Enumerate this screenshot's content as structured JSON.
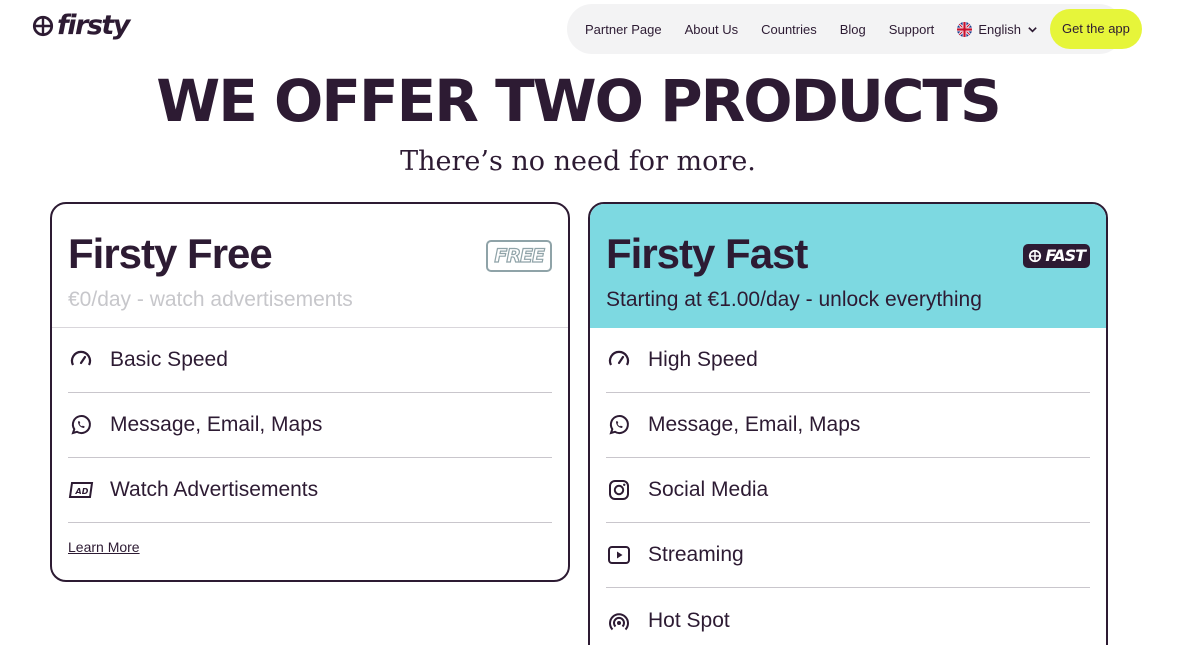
{
  "brand": {
    "name": "firsty"
  },
  "nav": {
    "items": [
      "Partner Page",
      "About Us",
      "Countries",
      "Blog",
      "Support"
    ],
    "language": "English",
    "cta": "Get the app"
  },
  "hero": {
    "title": "WE OFFER TWO PRODUCTS",
    "subtitle": "There’s no need for more."
  },
  "free": {
    "title": "Firsty Free",
    "badge": "FREE",
    "subtitle": "€0/day - watch advertisements",
    "features": [
      {
        "label": "Basic Speed",
        "icon": "speedometer-icon"
      },
      {
        "label": "Message, Email, Maps",
        "icon": "whatsapp-icon"
      },
      {
        "label": "Watch Advertisements",
        "icon": "ad-icon"
      }
    ],
    "learn_more": "Learn More"
  },
  "fast": {
    "title": "Firsty Fast",
    "badge": "FAST",
    "subtitle": "Starting at €1.00/day - unlock everything",
    "features": [
      {
        "label": "High Speed",
        "icon": "speedometer-icon"
      },
      {
        "label": "Message, Email, Maps",
        "icon": "whatsapp-icon"
      },
      {
        "label": "Social Media",
        "icon": "instagram-icon"
      },
      {
        "label": "Streaming",
        "icon": "play-icon"
      },
      {
        "label": "Hot Spot",
        "icon": "hotspot-icon"
      }
    ]
  },
  "colors": {
    "ink": "#2d1b33",
    "accent": "#e6f53a",
    "fast_bg": "#7dd9e1",
    "nav_bg": "#f3f3f4"
  }
}
